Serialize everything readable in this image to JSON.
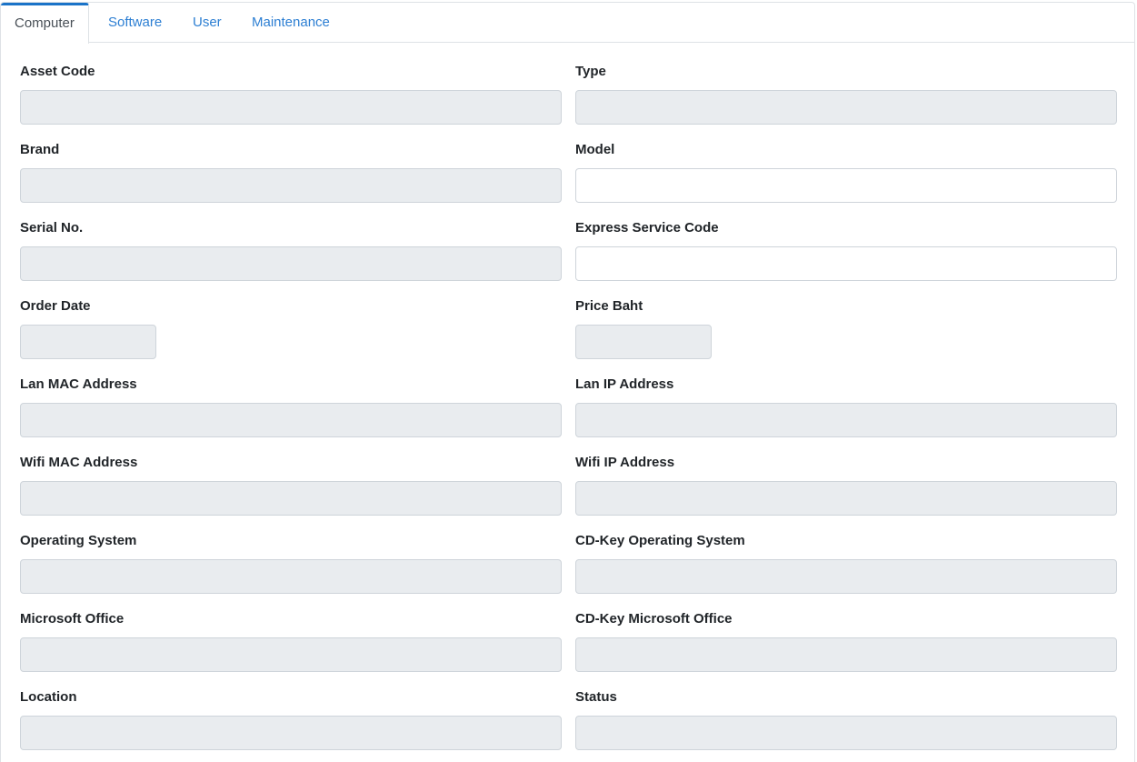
{
  "tabs": [
    {
      "label": "Computer",
      "active": true
    },
    {
      "label": "Software",
      "active": false
    },
    {
      "label": "User",
      "active": false
    },
    {
      "label": "Maintenance",
      "active": false
    }
  ],
  "fields": {
    "asset_code": {
      "label": "Asset Code",
      "value": ""
    },
    "type": {
      "label": "Type",
      "value": ""
    },
    "brand": {
      "label": "Brand",
      "value": ""
    },
    "model": {
      "label": "Model",
      "value": ""
    },
    "serial_no": {
      "label": "Serial No.",
      "value": ""
    },
    "express_service_code": {
      "label": "Express Service Code",
      "value": ""
    },
    "order_date": {
      "label": "Order Date",
      "value": ""
    },
    "price_baht": {
      "label": "Price Baht",
      "value": ""
    },
    "lan_mac": {
      "label": "Lan MAC Address",
      "value": ""
    },
    "lan_ip": {
      "label": "Lan IP Address",
      "value": ""
    },
    "wifi_mac": {
      "label": "Wifi MAC Address",
      "value": ""
    },
    "wifi_ip": {
      "label": "Wifi IP Address",
      "value": ""
    },
    "operating_system": {
      "label": "Operating System",
      "value": ""
    },
    "cdkey_os": {
      "label": "CD-Key Operating System",
      "value": ""
    },
    "microsoft_office": {
      "label": "Microsoft Office",
      "value": ""
    },
    "cdkey_office": {
      "label": "CD-Key Microsoft Office",
      "value": ""
    },
    "location": {
      "label": "Location",
      "value": ""
    },
    "status": {
      "label": "Status",
      "value": ""
    }
  },
  "colors": {
    "tab_link": "#2d7fd3",
    "tab_active_border": "#1a73c8",
    "readonly_bg": "#e9ecef",
    "input_border": "#ced4da"
  }
}
